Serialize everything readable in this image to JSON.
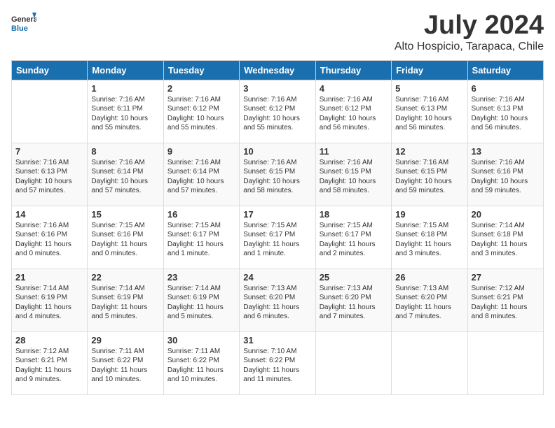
{
  "header": {
    "logo_general": "General",
    "logo_blue": "Blue",
    "month_year": "July 2024",
    "location": "Alto Hospicio, Tarapaca, Chile"
  },
  "days_of_week": [
    "Sunday",
    "Monday",
    "Tuesday",
    "Wednesday",
    "Thursday",
    "Friday",
    "Saturday"
  ],
  "weeks": [
    [
      {
        "day": "",
        "info": ""
      },
      {
        "day": "1",
        "info": "Sunrise: 7:16 AM\nSunset: 6:11 PM\nDaylight: 10 hours\nand 55 minutes."
      },
      {
        "day": "2",
        "info": "Sunrise: 7:16 AM\nSunset: 6:12 PM\nDaylight: 10 hours\nand 55 minutes."
      },
      {
        "day": "3",
        "info": "Sunrise: 7:16 AM\nSunset: 6:12 PM\nDaylight: 10 hours\nand 55 minutes."
      },
      {
        "day": "4",
        "info": "Sunrise: 7:16 AM\nSunset: 6:12 PM\nDaylight: 10 hours\nand 56 minutes."
      },
      {
        "day": "5",
        "info": "Sunrise: 7:16 AM\nSunset: 6:13 PM\nDaylight: 10 hours\nand 56 minutes."
      },
      {
        "day": "6",
        "info": "Sunrise: 7:16 AM\nSunset: 6:13 PM\nDaylight: 10 hours\nand 56 minutes."
      }
    ],
    [
      {
        "day": "7",
        "info": "Sunrise: 7:16 AM\nSunset: 6:13 PM\nDaylight: 10 hours\nand 57 minutes."
      },
      {
        "day": "8",
        "info": "Sunrise: 7:16 AM\nSunset: 6:14 PM\nDaylight: 10 hours\nand 57 minutes."
      },
      {
        "day": "9",
        "info": "Sunrise: 7:16 AM\nSunset: 6:14 PM\nDaylight: 10 hours\nand 57 minutes."
      },
      {
        "day": "10",
        "info": "Sunrise: 7:16 AM\nSunset: 6:15 PM\nDaylight: 10 hours\nand 58 minutes."
      },
      {
        "day": "11",
        "info": "Sunrise: 7:16 AM\nSunset: 6:15 PM\nDaylight: 10 hours\nand 58 minutes."
      },
      {
        "day": "12",
        "info": "Sunrise: 7:16 AM\nSunset: 6:15 PM\nDaylight: 10 hours\nand 59 minutes."
      },
      {
        "day": "13",
        "info": "Sunrise: 7:16 AM\nSunset: 6:16 PM\nDaylight: 10 hours\nand 59 minutes."
      }
    ],
    [
      {
        "day": "14",
        "info": "Sunrise: 7:16 AM\nSunset: 6:16 PM\nDaylight: 11 hours\nand 0 minutes."
      },
      {
        "day": "15",
        "info": "Sunrise: 7:15 AM\nSunset: 6:16 PM\nDaylight: 11 hours\nand 0 minutes."
      },
      {
        "day": "16",
        "info": "Sunrise: 7:15 AM\nSunset: 6:17 PM\nDaylight: 11 hours\nand 1 minute."
      },
      {
        "day": "17",
        "info": "Sunrise: 7:15 AM\nSunset: 6:17 PM\nDaylight: 11 hours\nand 1 minute."
      },
      {
        "day": "18",
        "info": "Sunrise: 7:15 AM\nSunset: 6:17 PM\nDaylight: 11 hours\nand 2 minutes."
      },
      {
        "day": "19",
        "info": "Sunrise: 7:15 AM\nSunset: 6:18 PM\nDaylight: 11 hours\nand 3 minutes."
      },
      {
        "day": "20",
        "info": "Sunrise: 7:14 AM\nSunset: 6:18 PM\nDaylight: 11 hours\nand 3 minutes."
      }
    ],
    [
      {
        "day": "21",
        "info": "Sunrise: 7:14 AM\nSunset: 6:19 PM\nDaylight: 11 hours\nand 4 minutes."
      },
      {
        "day": "22",
        "info": "Sunrise: 7:14 AM\nSunset: 6:19 PM\nDaylight: 11 hours\nand 5 minutes."
      },
      {
        "day": "23",
        "info": "Sunrise: 7:14 AM\nSunset: 6:19 PM\nDaylight: 11 hours\nand 5 minutes."
      },
      {
        "day": "24",
        "info": "Sunrise: 7:13 AM\nSunset: 6:20 PM\nDaylight: 11 hours\nand 6 minutes."
      },
      {
        "day": "25",
        "info": "Sunrise: 7:13 AM\nSunset: 6:20 PM\nDaylight: 11 hours\nand 7 minutes."
      },
      {
        "day": "26",
        "info": "Sunrise: 7:13 AM\nSunset: 6:20 PM\nDaylight: 11 hours\nand 7 minutes."
      },
      {
        "day": "27",
        "info": "Sunrise: 7:12 AM\nSunset: 6:21 PM\nDaylight: 11 hours\nand 8 minutes."
      }
    ],
    [
      {
        "day": "28",
        "info": "Sunrise: 7:12 AM\nSunset: 6:21 PM\nDaylight: 11 hours\nand 9 minutes."
      },
      {
        "day": "29",
        "info": "Sunrise: 7:11 AM\nSunset: 6:22 PM\nDaylight: 11 hours\nand 10 minutes."
      },
      {
        "day": "30",
        "info": "Sunrise: 7:11 AM\nSunset: 6:22 PM\nDaylight: 11 hours\nand 10 minutes."
      },
      {
        "day": "31",
        "info": "Sunrise: 7:10 AM\nSunset: 6:22 PM\nDaylight: 11 hours\nand 11 minutes."
      },
      {
        "day": "",
        "info": ""
      },
      {
        "day": "",
        "info": ""
      },
      {
        "day": "",
        "info": ""
      }
    ]
  ]
}
